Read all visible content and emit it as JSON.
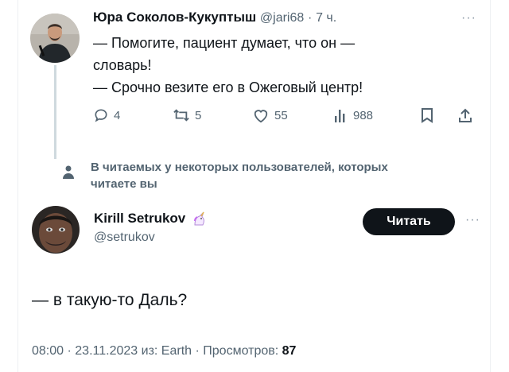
{
  "reply_to_tweet": {
    "author_name": "Юра Соколов-Кукуптыш",
    "author_handle": "@jari68",
    "separator": "·",
    "time_ago": "7 ч.",
    "more": "···",
    "text_lines": [
      "— Помогите, пациент думает, что он —",
      "словарь!",
      "— Срочно везите его в Ожеговый центр!"
    ],
    "actions": {
      "replies": "4",
      "retweets": "5",
      "likes": "55",
      "views": "988"
    }
  },
  "visibility_notice": {
    "text_line1": "В читаемых у некоторых пользователей, которых",
    "text_line2": "читаете вы"
  },
  "main_tweet": {
    "author_name": "Kirill Setrukov",
    "author_handle": "@setrukov",
    "badge_icon": "unicorn",
    "follow_label": "Читать",
    "more": "···",
    "text": "— в такую-то Даль?",
    "meta_time": "08:00",
    "meta_date": "23.11.2023",
    "meta_sep": "·",
    "meta_source": "из: Earth",
    "meta_views_label": "Просмотров:",
    "meta_views_count": "87"
  },
  "colors": {
    "text_primary": "#0f1419",
    "text_secondary": "#536471",
    "button_bg": "#0f1419",
    "thread_line": "#cfd9de"
  }
}
